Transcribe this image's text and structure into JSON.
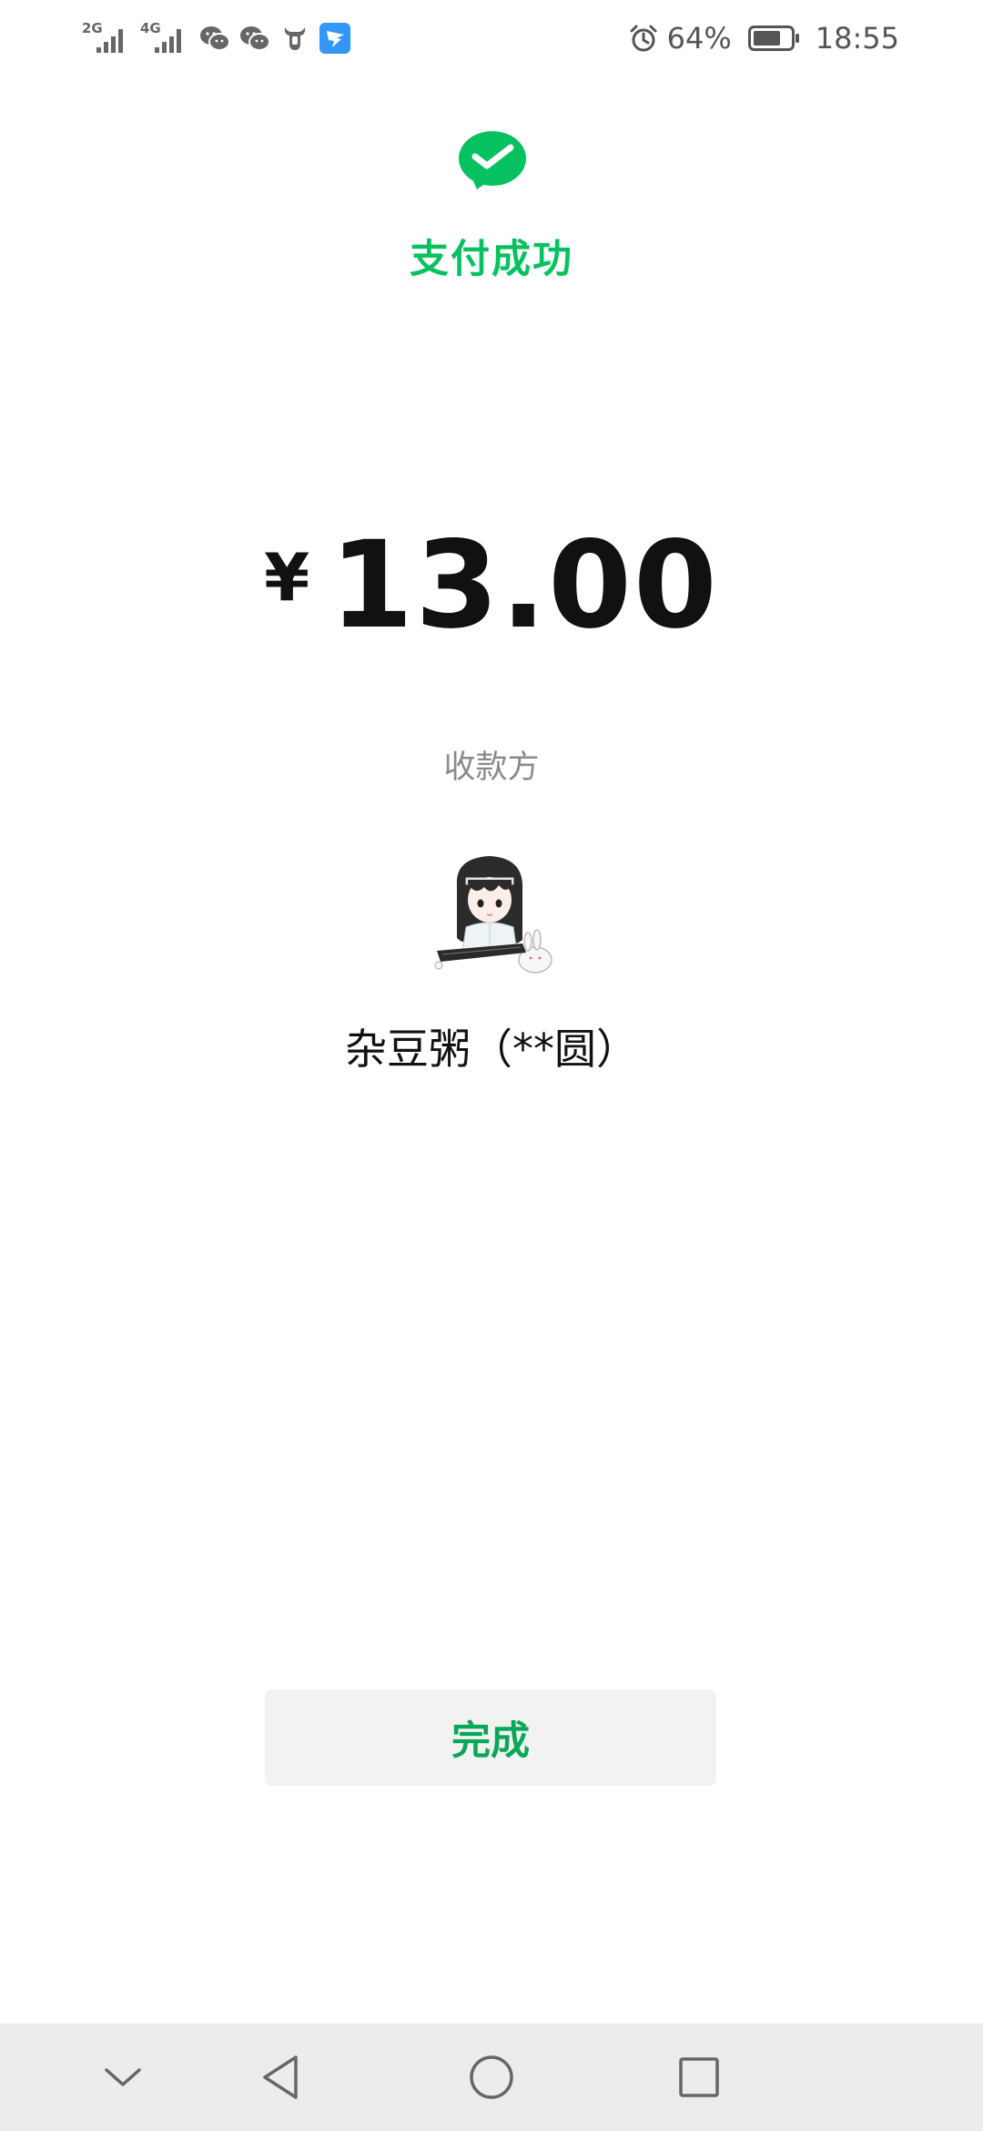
{
  "status_bar": {
    "signal_1_label": "2G",
    "signal_2_label": "4G",
    "battery_percent": "64%",
    "time": "18:55",
    "icons": [
      "signal-icon",
      "signal-icon",
      "wechat-icon",
      "wechat-icon",
      "bull-app-icon",
      "dingtalk-icon",
      "alarm-icon",
      "battery-icon"
    ]
  },
  "header": {
    "title": "支付成功",
    "logo_icon": "wechat-pay-icon"
  },
  "payment": {
    "currency_symbol": "¥",
    "amount": "13.00"
  },
  "payee": {
    "label": "收款方",
    "name": "杂豆粥（**圆）",
    "avatar_icon": "payee-avatar"
  },
  "actions": {
    "done_label": "完成"
  },
  "nav": {
    "icons": [
      "chevron-down-icon",
      "back-icon",
      "home-icon",
      "recents-icon"
    ]
  },
  "colors": {
    "accent": "#07c160",
    "text_primary": "#111111",
    "text_secondary": "#8a8a8a",
    "button_bg": "#f2f2f2",
    "nav_bg": "#ececec"
  }
}
